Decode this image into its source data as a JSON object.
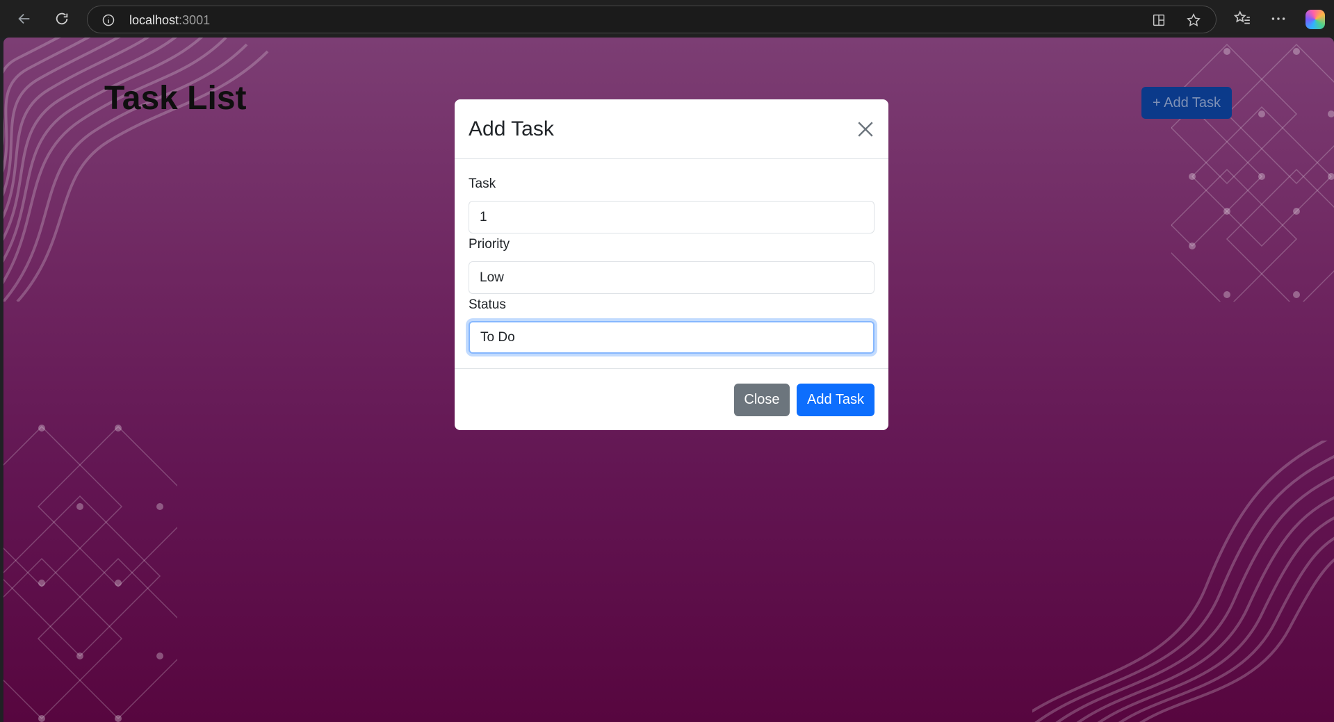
{
  "browser": {
    "url_host": "localhost",
    "url_port": ":3001",
    "icons": [
      "back-arrow-icon",
      "refresh-icon",
      "info-icon",
      "split-screen-icon",
      "star-icon",
      "favorites-icon",
      "more-icon",
      "copilot-icon"
    ]
  },
  "page": {
    "title": "Task List",
    "add_button_label": "+ Add Task"
  },
  "modal": {
    "title": "Add Task",
    "fields": [
      {
        "label": "Task",
        "value": "1"
      },
      {
        "label": "Priority",
        "value": "Low"
      },
      {
        "label": "Status",
        "value": "To Do"
      }
    ],
    "close_label": "Close",
    "submit_label": "Add Task"
  },
  "colors": {
    "background_top": "#7c3e74",
    "background_bottom": "#57063f",
    "primary": "#0d6efd",
    "secondary": "#6c757d"
  }
}
